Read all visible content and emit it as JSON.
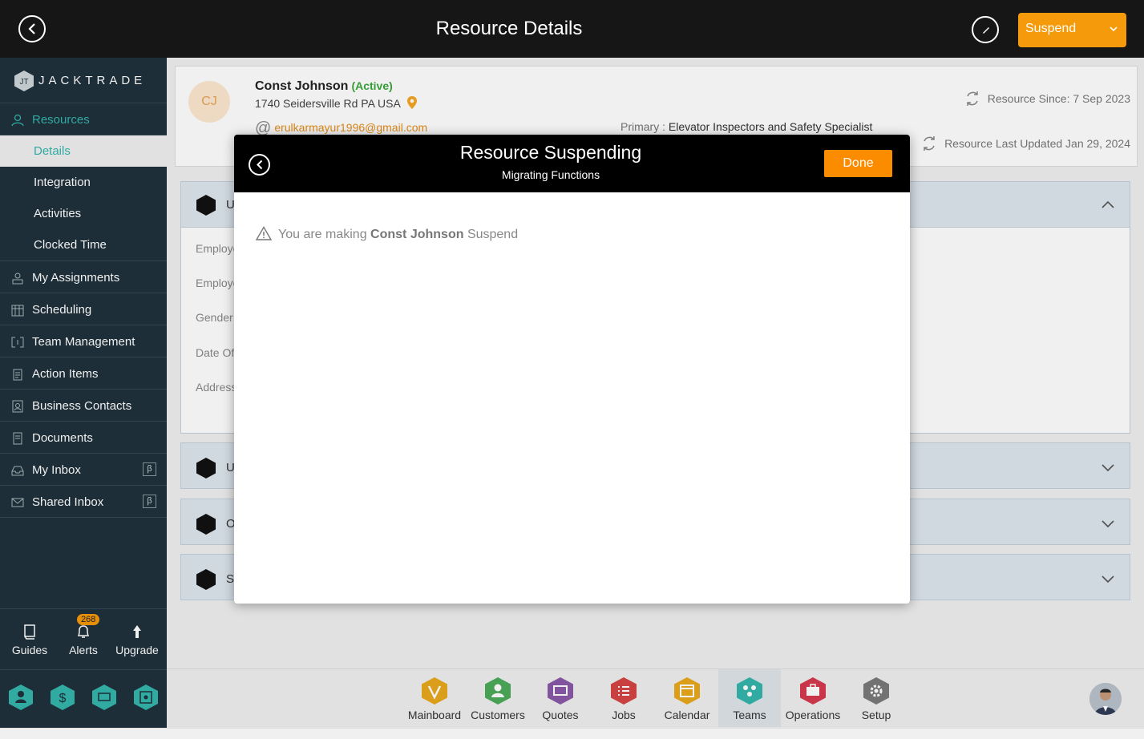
{
  "header": {
    "title": "Resource Details",
    "suspend_label": "Suspend"
  },
  "brand": {
    "name": "JACKTRADE",
    "tm": "™"
  },
  "sidebar": {
    "resources": "Resources",
    "sub": [
      "Details",
      "Integration",
      "Activities",
      "Clocked Time"
    ],
    "items": [
      "My Assignments",
      "Scheduling",
      "Team Management",
      "Action Items",
      "Business Contacts",
      "Documents",
      "My Inbox",
      "Shared Inbox"
    ],
    "beta": "β",
    "tools": {
      "guides": "Guides",
      "alerts": "Alerts",
      "alerts_count": "268",
      "upgrade": "Upgrade"
    }
  },
  "profile": {
    "initials": "CJ",
    "name": "Const Johnson",
    "status": "(Active)",
    "address": "1740 Seidersville Rd PA USA",
    "email": "erulkarmayur1996@gmail.com",
    "primary_key": "Primary :",
    "primary_value": "Elevator Inspectors and Safety Specialist",
    "since": "Resource Since: 7 Sep 2023",
    "updated": "Resource Last Updated Jan 29, 2024"
  },
  "sections": {
    "s1": "U",
    "s2": "U",
    "s3": "O",
    "s4": "S",
    "fields": [
      "Employe",
      "Employe",
      "Gender",
      "Date Of",
      "Address"
    ]
  },
  "apps": [
    "Mainboard",
    "Customers",
    "Quotes",
    "Jobs",
    "Calendar",
    "Teams",
    "Operations",
    "Setup"
  ],
  "colors": {
    "accent": "#f59a0a",
    "teal": "#35b5ad",
    "sidebar": "#1f313c",
    "app_mainboard": "#e8a81c",
    "app_customers": "#4caa5a",
    "app_quotes": "#8c5aa8",
    "app_jobs": "#d64545",
    "app_calendar": "#e8a81c",
    "app_teams": "#35b5ad",
    "app_operations": "#d63a4e",
    "app_setup": "#7a7a7a"
  },
  "modal": {
    "title": "Resource Suspending",
    "subtitle": "Migrating Functions",
    "done": "Done",
    "msg_prefix": "You are making",
    "msg_name": "Const Johnson",
    "msg_suffix": "Suspend"
  }
}
